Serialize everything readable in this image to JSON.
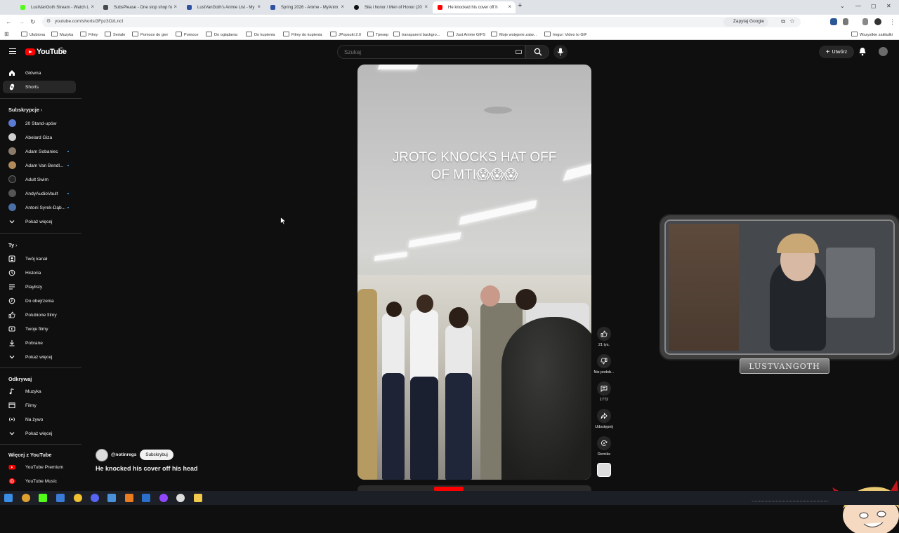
{
  "browser": {
    "tabs": [
      {
        "title": "LustVanGoth Stream - Watch L",
        "active": false,
        "favicon_color": "#53fc18"
      },
      {
        "title": "SubsPlease - One stop shop fo",
        "active": false,
        "favicon_color": "#4a4a4a"
      },
      {
        "title": "LustVanGoth's Anime List - My",
        "active": false,
        "favicon_color": "#2e51a2"
      },
      {
        "title": "Spring 2026 - Anime - MyAnim",
        "active": false,
        "favicon_color": "#2e51a2"
      },
      {
        "title": "Siła i honor / Men of Honor (20",
        "active": false,
        "favicon_color": "#111111"
      },
      {
        "title": "He knocked his cover off h",
        "active": true,
        "favicon_color": "#ff0000"
      }
    ],
    "url": "youtube.com/shorts/3Fpz3OzLncI",
    "ask_google": "Zapytaj Google",
    "bookmarks": [
      "Ulubiona",
      "Muzyka",
      "Filmy",
      "Seriale",
      "Pomoce do gier",
      "Pomoce",
      "Do oglądania",
      "Do kupienia",
      "Filmy do kupienia",
      "JPopsuki 2.0",
      "Трекер",
      "transparent backgro...",
      "Just Anime GIFS",
      "Moje wstępnie zatw...",
      "Imgur: Video to GIF"
    ],
    "all_bookmarks": "Wszystkie zakładki"
  },
  "youtube": {
    "logo": "YouTube",
    "country": "PL",
    "search_placeholder": "Szukaj",
    "create_label": "Utwórz",
    "sidebar": {
      "main": [
        {
          "label": "Główna",
          "icon": "home-icon",
          "active": false
        },
        {
          "label": "Shorts",
          "icon": "shorts-icon",
          "active": true
        }
      ],
      "subscriptions_header": "Subskrypcje",
      "subscriptions": [
        {
          "label": "20 Stand-upów",
          "color": "#5b7bd5",
          "new": false
        },
        {
          "label": "Abelard Giza",
          "color": "#cfcfcf",
          "new": false
        },
        {
          "label": "Adam Sobaniec",
          "color": "#8a7a6a",
          "new": true
        },
        {
          "label": "Adam Van Bendl...",
          "color": "#b08a5a",
          "new": true
        },
        {
          "label": "Adult Swim",
          "color": "#222222",
          "new": false
        },
        {
          "label": "AndyAudioVault",
          "color": "#555555",
          "new": true
        },
        {
          "label": "Antoni Syrek-Dąb...",
          "color": "#4a6fa5",
          "new": true
        }
      ],
      "show_more_1": "Pokaż więcej",
      "you_header": "Ty",
      "you": [
        {
          "label": "Twój kanał",
          "icon": "channel-icon"
        },
        {
          "label": "Historia",
          "icon": "history-icon"
        },
        {
          "label": "Playlisty",
          "icon": "playlists-icon"
        },
        {
          "label": "Do obejrzenia",
          "icon": "watch-later-icon"
        },
        {
          "label": "Polubione filmy",
          "icon": "liked-icon"
        },
        {
          "label": "Twoje filmy",
          "icon": "your-videos-icon"
        },
        {
          "label": "Pobrane",
          "icon": "download-icon"
        }
      ],
      "show_more_2": "Pokaż więcej",
      "explore_header": "Odkrywaj",
      "explore": [
        {
          "label": "Muzyka",
          "icon": "music-icon"
        },
        {
          "label": "Filmy",
          "icon": "film-icon"
        },
        {
          "label": "Na żywo",
          "icon": "live-icon"
        }
      ],
      "show_more_3": "Pokaż więcej",
      "more_header": "Więcej z YouTube",
      "more": [
        {
          "label": "YouTube Premium",
          "color": "#ff0000"
        },
        {
          "label": "YouTube Music",
          "color": "#ff0000"
        }
      ]
    },
    "short": {
      "overlay_text_line1": "JROTC KNOCKS HAT OFF",
      "overlay_text_line2": "OF MTI😱😱😱",
      "channel": "@notinregs",
      "subscribe_label": "Subskrybuj",
      "title": "He knocked his cover off his head"
    },
    "actions": [
      {
        "name": "like",
        "icon": "thumbs-up-icon",
        "label": "21 tys."
      },
      {
        "name": "dislike",
        "icon": "thumbs-down-icon",
        "label": "Nie podob..."
      },
      {
        "name": "comments",
        "icon": "comment-icon",
        "label": "1772"
      },
      {
        "name": "share",
        "icon": "share-icon",
        "label": "Udostępnij"
      },
      {
        "name": "remix",
        "icon": "remix-icon",
        "label": "Remiks"
      }
    ]
  },
  "webcam": {
    "label": "LUSTVANGOTH"
  }
}
